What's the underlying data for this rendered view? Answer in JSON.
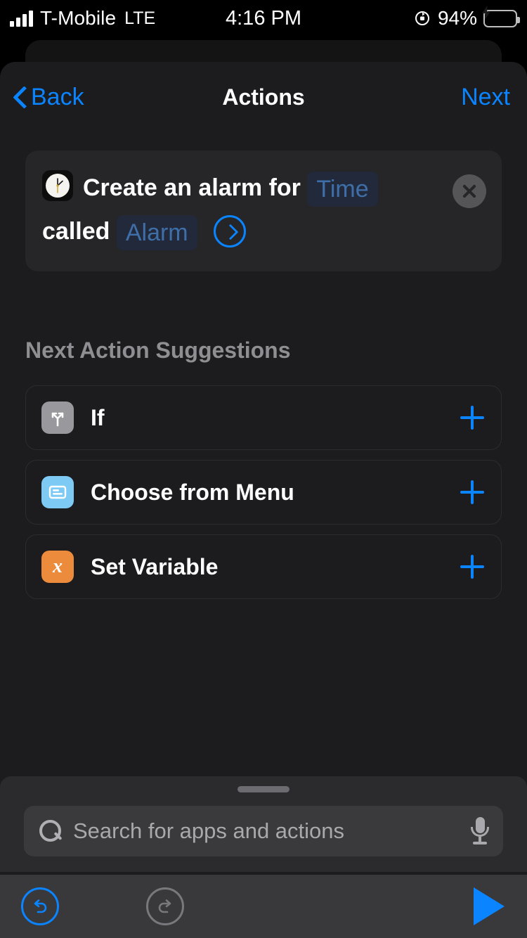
{
  "status_bar": {
    "carrier": "T-Mobile",
    "network": "LTE",
    "time": "4:16 PM",
    "battery_percent": "94%",
    "signal_icon": "signal-bars-icon",
    "rotation_lock_icon": "rotation-lock-icon",
    "battery_icon": "battery-charging-icon"
  },
  "nav": {
    "back_label": "Back",
    "title": "Actions",
    "next_label": "Next",
    "back_icon": "chevron-left-icon"
  },
  "action_card": {
    "app_icon": "clock-app-icon",
    "text_part1": "Create an alarm for",
    "token_time": "Time",
    "text_part2": "called",
    "token_name": "Alarm",
    "expand_icon": "chevron-right-circle-icon",
    "close_icon": "close-circle-icon"
  },
  "suggestions": {
    "header": "Next Action Suggestions",
    "add_icon": "plus-icon",
    "items": [
      {
        "label": "If",
        "icon": "branch-fork-icon",
        "icon_bg": "#98989d"
      },
      {
        "label": "Choose from Menu",
        "icon": "menu-card-icon",
        "icon_bg": "#7dcbf5"
      },
      {
        "label": "Set Variable",
        "icon": "variable-x-icon",
        "icon_bg": "#ec8b3c",
        "glyph": "x"
      }
    ]
  },
  "drawer": {
    "grabber_icon": "drag-handle-icon",
    "search_placeholder": "Search for apps and actions",
    "search_value": "",
    "search_icon": "search-icon",
    "mic_icon": "microphone-icon"
  },
  "toolbar": {
    "undo_icon": "undo-icon",
    "redo_icon": "redo-icon",
    "play_icon": "play-icon"
  },
  "colors": {
    "accent": "#0a84ff",
    "sheet_bg": "#1c1c1e",
    "card_bg": "#262628",
    "token_bg": "#22293a",
    "token_text": "#3f6fa8",
    "secondary_text": "#8e8e93"
  }
}
